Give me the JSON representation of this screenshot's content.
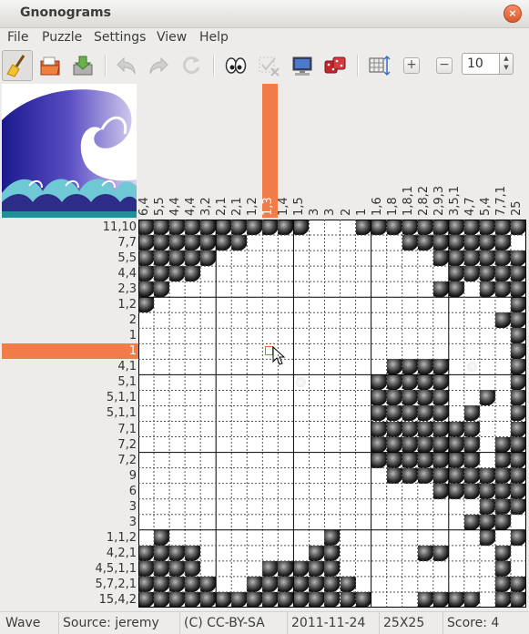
{
  "window": {
    "title": "Gnonograms",
    "close_glyph": "×"
  },
  "menu": [
    "File",
    "Puzzle",
    "Settings",
    "View",
    "Help"
  ],
  "toolbar": {
    "buttons": [
      {
        "name": "solve-brush",
        "icon": "broom-icon"
      },
      {
        "name": "open",
        "icon": "folder-open-icon"
      },
      {
        "name": "save",
        "icon": "download-icon"
      },
      {
        "name": "undo",
        "icon": "undo-icon"
      },
      {
        "name": "redo",
        "icon": "redo-icon"
      },
      {
        "name": "restart",
        "icon": "restart-icon"
      },
      {
        "name": "hint",
        "icon": "eyes-icon"
      },
      {
        "name": "check-errors",
        "icon": "check-grid-icon"
      },
      {
        "name": "computer-solve",
        "icon": "computer-icon"
      },
      {
        "name": "random",
        "icon": "dice-icon"
      },
      {
        "name": "resize",
        "icon": "resize-grid-icon"
      }
    ],
    "zoom_in": "+",
    "zoom_out": "−",
    "zoom_value": "10"
  },
  "puzzle": {
    "size": 25,
    "col_clues": [
      "6,4",
      "5,5",
      "4,4",
      "4,4",
      "3,2",
      "2,1",
      "2,1",
      "1,2",
      "1,3",
      "1,4",
      "1,5",
      "3",
      "3",
      "2",
      "1",
      "1,6",
      "1,8",
      "1,8,1",
      "2,8,2",
      "2,9,3",
      "3,5,1",
      "4,7",
      "5,4",
      "7,7,1",
      "25"
    ],
    "row_clues": [
      "11,10",
      "7,7",
      "5,5",
      "4,4",
      "2,3",
      "1,2",
      "2",
      "1",
      "1",
      "4,1",
      "5,1",
      "5,1,1",
      "5,1,1",
      "7,1",
      "7,2",
      "7,2",
      "9",
      "6",
      "3",
      "3",
      "1,1,2",
      "4,2,1",
      "4,5,1,1",
      "5,7,2,1",
      "15,4,2"
    ],
    "highlight_row": 8,
    "highlight_col": 8,
    "grid": [
      "FFFFFFFFFFF...FFFFFFFFFFF",
      "FFFFFFF..........FFFFFFF.",
      "FFFFF..............FFFFFF",
      "FFFF................FFFFF",
      "FF.................FF.FFF",
      "F.......................F",
      ".......................FF",
      "........................F",
      "........................F",
      "................FFFF.E..F",
      "..........E....FFFFF....F",
      "...............FFFFF..F.F",
      "...............FFFFF.F..F",
      "...............FFFFFFF..F",
      "...............FFFFFFF.FF",
      "...............FFFFFFF.FF",
      "................FFFFFFFFF",
      "...................FFFFFF",
      "......................FFF",
      ".....................FFF.",
      ".F..........F.........F.F",
      "FFFF.......FF.....FF...F.",
      "FFFF....FFFFF..........F.",
      "FFFFF..FFFFFFF.........FF",
      "FFFFFFFFFFFFFFF...FFFF.FF"
    ]
  },
  "status": {
    "name": "Wave",
    "source": "Source: jeremy",
    "license": "(C)  CC-BY-SA",
    "date": "2011-11-24",
    "dimensions": "25X25",
    "score": "Score: 4"
  }
}
